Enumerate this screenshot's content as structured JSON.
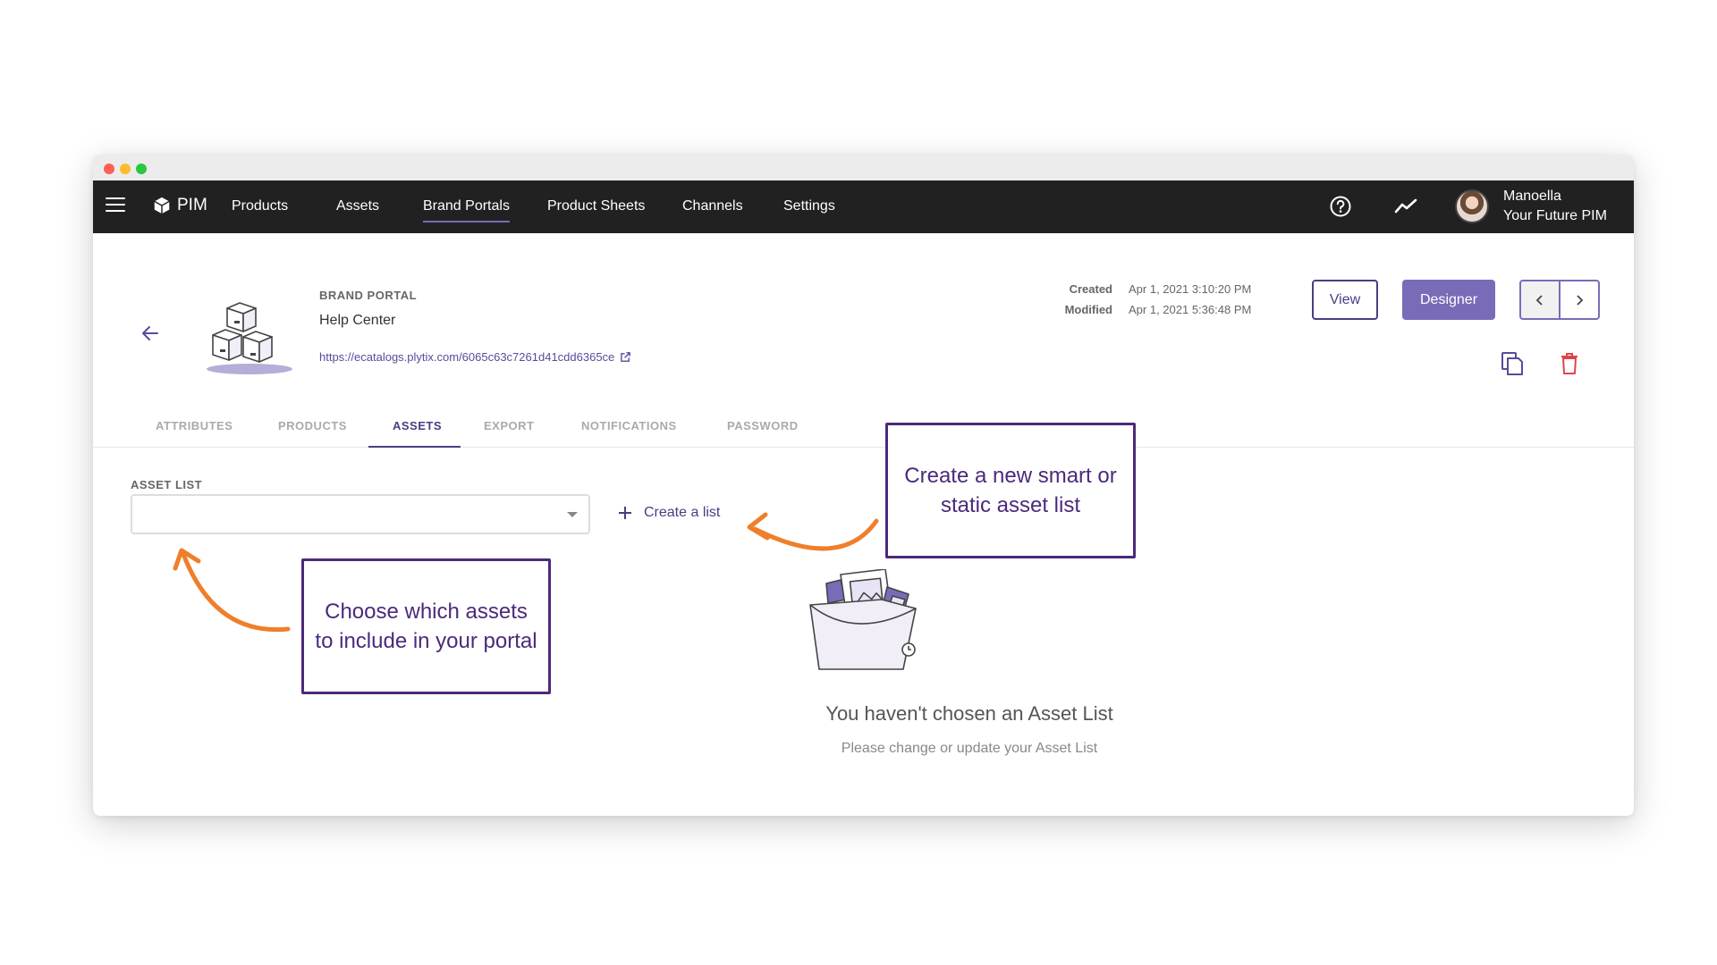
{
  "nav": {
    "logo": "PIM",
    "items": [
      "Products",
      "Assets",
      "Brand Portals",
      "Product Sheets",
      "Channels",
      "Settings"
    ],
    "active": "Brand Portals",
    "user_name": "Manoella",
    "user_org": "Your Future PIM"
  },
  "header": {
    "section_label": "BRAND PORTAL",
    "title": "Help Center",
    "url": "https://ecatalogs.plytix.com/6065c63c7261d41cdd6365ce",
    "created_label": "Created",
    "created_value": "Apr 1, 2021 3:10:20 PM",
    "modified_label": "Modified",
    "modified_value": "Apr 1, 2021 5:36:48 PM",
    "view_label": "View",
    "designer_label": "Designer"
  },
  "tabs": [
    "ATTRIBUTES",
    "PRODUCTS",
    "ASSETS",
    "EXPORT",
    "NOTIFICATIONS",
    "PASSWORD"
  ],
  "active_tab": "ASSETS",
  "assets": {
    "field_label": "ASSET LIST",
    "select_value": "",
    "create_label": "Create a list",
    "empty_title": "You haven't chosen an Asset List",
    "empty_sub": "Please change or update your Asset List"
  },
  "callouts": {
    "create": "Create a new smart or static asset list",
    "choose": "Choose which assets to include in your portal"
  },
  "colors": {
    "accent": "#7a6bb8",
    "dark_accent": "#4a3d82",
    "callout": "#4b2a7b",
    "arrow": "#ef7f2a",
    "delete": "#e0424b",
    "nav_bg": "#212121"
  }
}
